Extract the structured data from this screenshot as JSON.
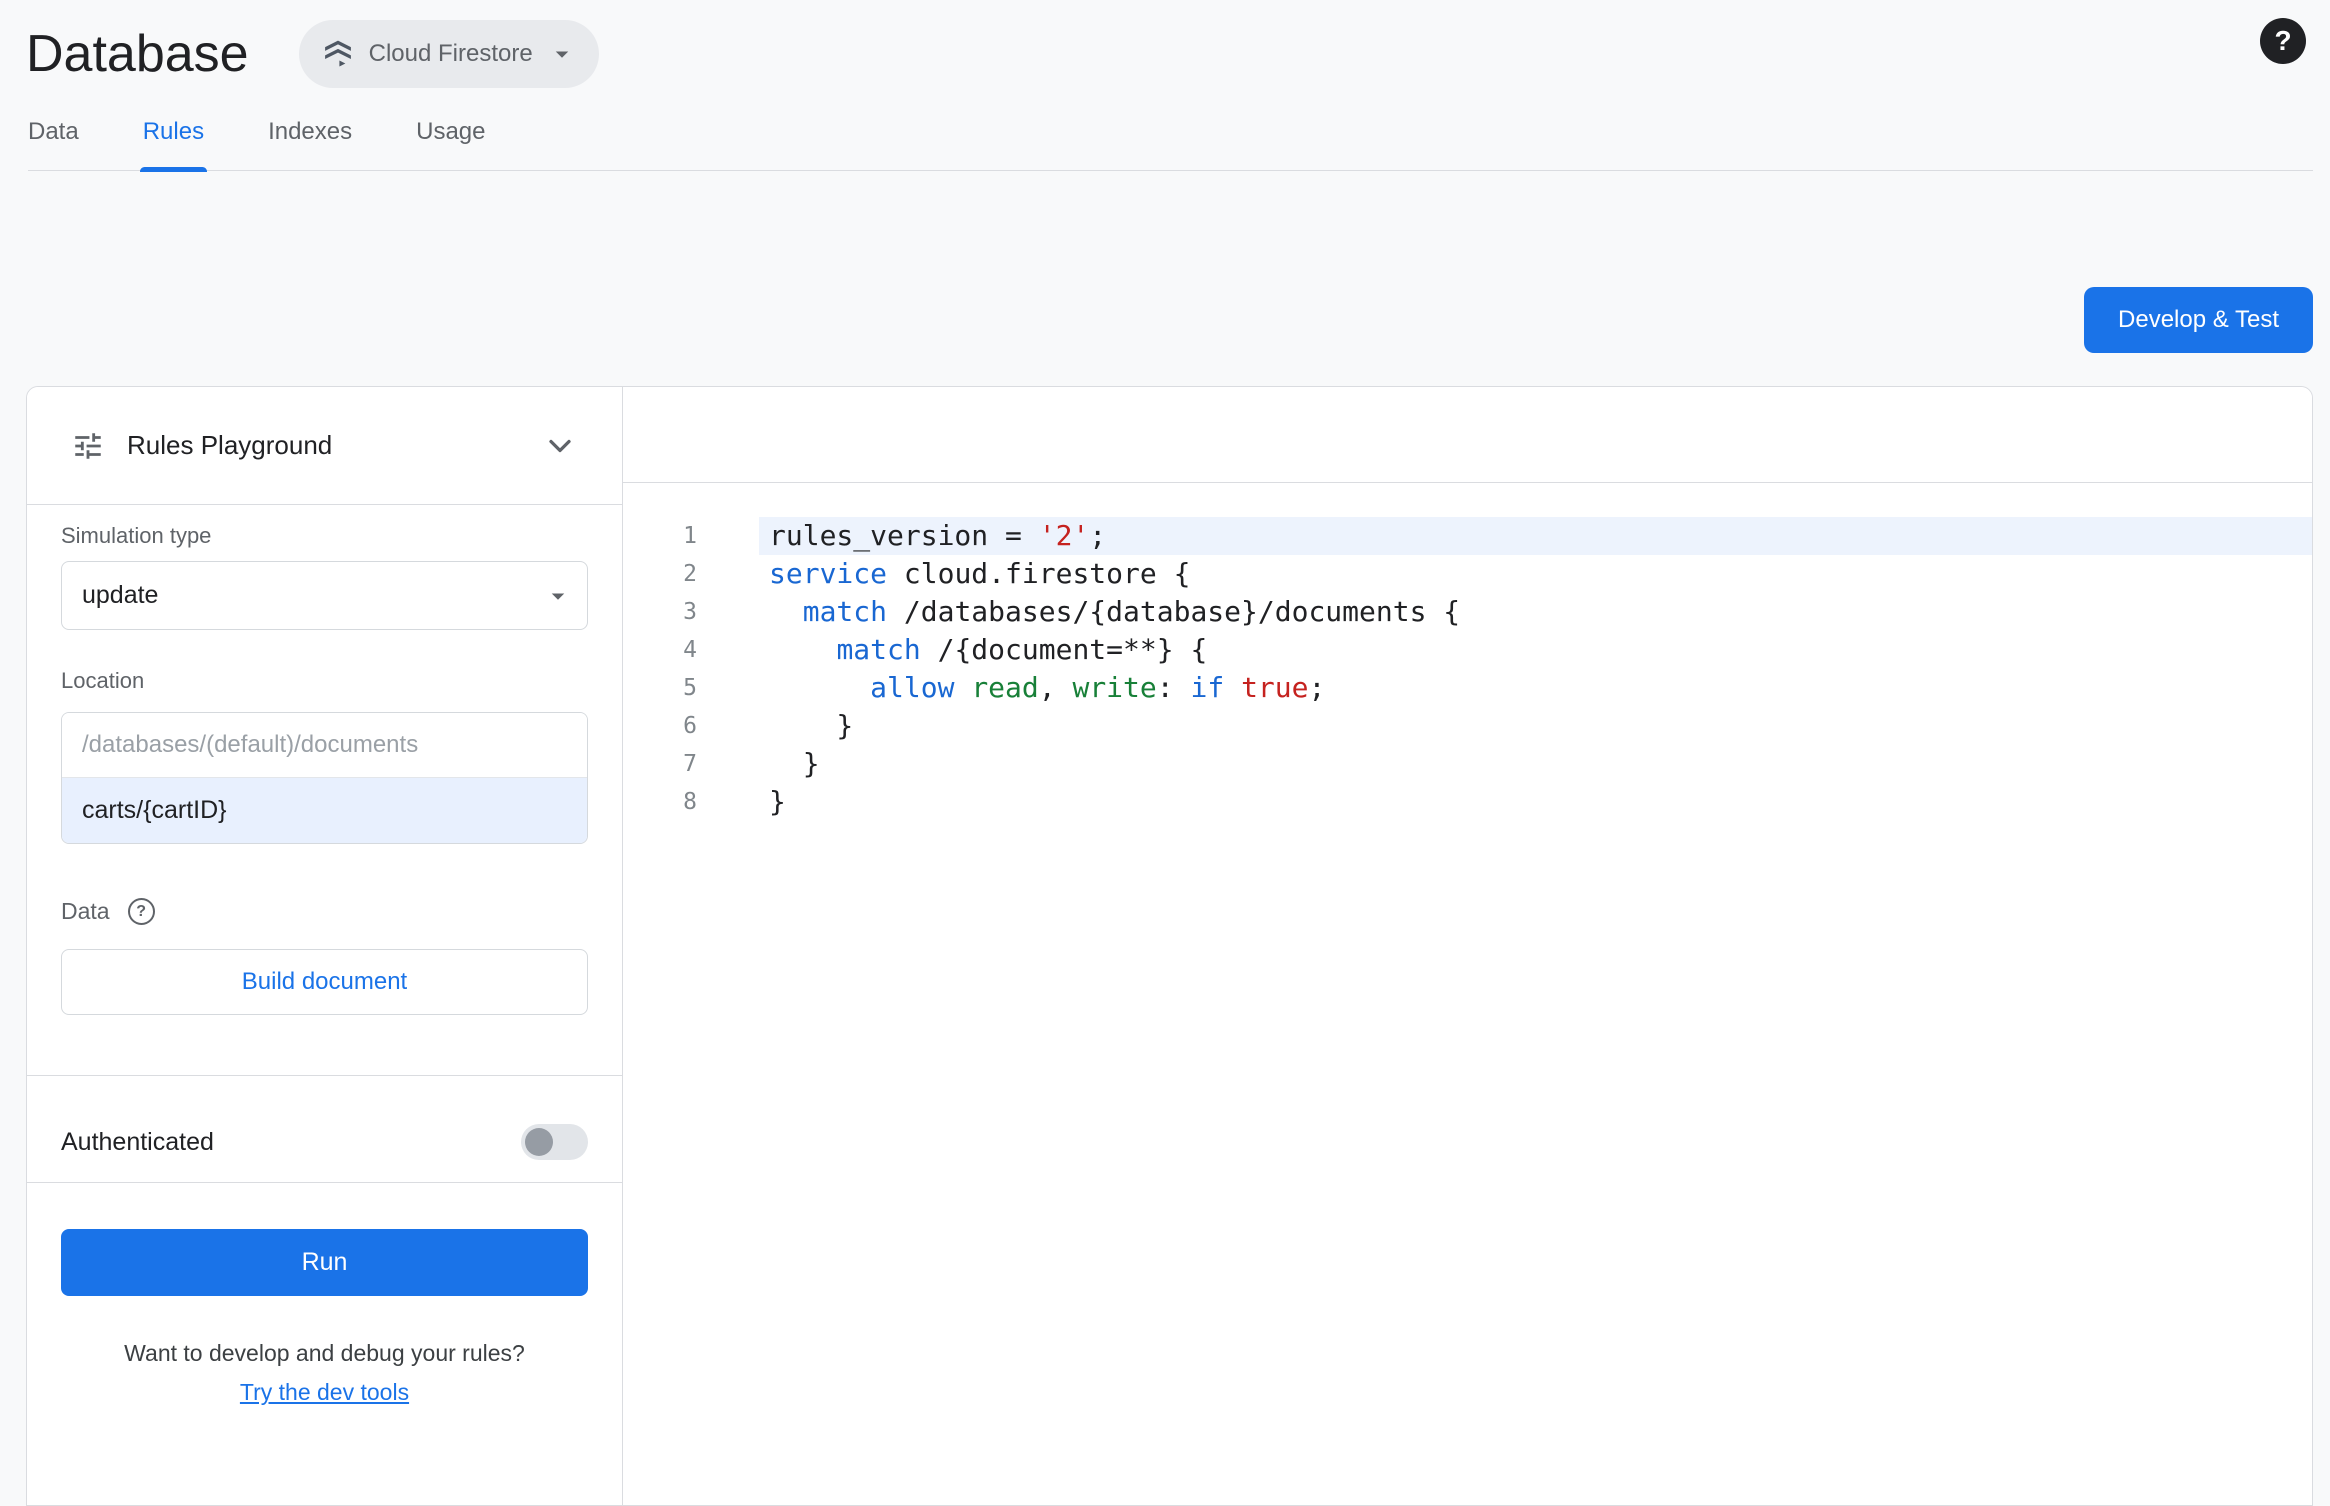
{
  "colors": {
    "accent_blue": "#1a73e8",
    "keyword_blue": "#1967d2",
    "string_red": "#c5221f",
    "permission_green": "#188038",
    "highlight_line": "#edf3fd",
    "location_value_bg": "#e8f0fe"
  },
  "header": {
    "title": "Database",
    "product_selector_label": "Cloud Firestore",
    "help_icon": "?"
  },
  "tabs": [
    {
      "label": "Data",
      "active": false
    },
    {
      "label": "Rules",
      "active": true
    },
    {
      "label": "Indexes",
      "active": false
    },
    {
      "label": "Usage",
      "active": false
    }
  ],
  "actions": {
    "develop_test_label": "Develop & Test"
  },
  "playground": {
    "title": "Rules Playground",
    "simulation_type": {
      "label": "Simulation type",
      "value": "update"
    },
    "location": {
      "label": "Location",
      "placeholder": "/databases/(default)/documents",
      "value": "carts/{cartID}"
    },
    "data_section": {
      "label": "Data",
      "help_icon": "?",
      "build_button_label": "Build document"
    },
    "authenticated": {
      "label": "Authenticated",
      "enabled": false
    },
    "run_button_label": "Run",
    "footer": {
      "text": "Want to develop and debug your rules?",
      "link": "Try the dev tools"
    }
  },
  "editor": {
    "lines": [
      {
        "num": 1,
        "highlight": true,
        "tokens": [
          [
            "plain",
            "rules_version = "
          ],
          [
            "str",
            "'2'"
          ],
          [
            "plain",
            ";"
          ]
        ]
      },
      {
        "num": 2,
        "highlight": false,
        "tokens": [
          [
            "kw",
            "service"
          ],
          [
            "plain",
            " cloud.firestore {"
          ]
        ]
      },
      {
        "num": 3,
        "highlight": false,
        "tokens": [
          [
            "plain",
            "  "
          ],
          [
            "kw",
            "match"
          ],
          [
            "plain",
            " /databases/{database}/documents {"
          ]
        ]
      },
      {
        "num": 4,
        "highlight": false,
        "tokens": [
          [
            "plain",
            "    "
          ],
          [
            "kw",
            "match"
          ],
          [
            "plain",
            " /{document=**} {"
          ]
        ]
      },
      {
        "num": 5,
        "highlight": false,
        "tokens": [
          [
            "plain",
            "      "
          ],
          [
            "kw",
            "allow"
          ],
          [
            "plain",
            " "
          ],
          [
            "perm",
            "read"
          ],
          [
            "plain",
            ", "
          ],
          [
            "perm",
            "write"
          ],
          [
            "plain",
            ": "
          ],
          [
            "kw",
            "if"
          ],
          [
            "plain",
            " "
          ],
          [
            "bool",
            "true"
          ],
          [
            "plain",
            ";"
          ]
        ]
      },
      {
        "num": 6,
        "highlight": false,
        "tokens": [
          [
            "plain",
            "    }"
          ]
        ]
      },
      {
        "num": 7,
        "highlight": false,
        "tokens": [
          [
            "plain",
            "  }"
          ]
        ]
      },
      {
        "num": 8,
        "highlight": false,
        "tokens": [
          [
            "plain",
            "}"
          ]
        ]
      }
    ]
  }
}
